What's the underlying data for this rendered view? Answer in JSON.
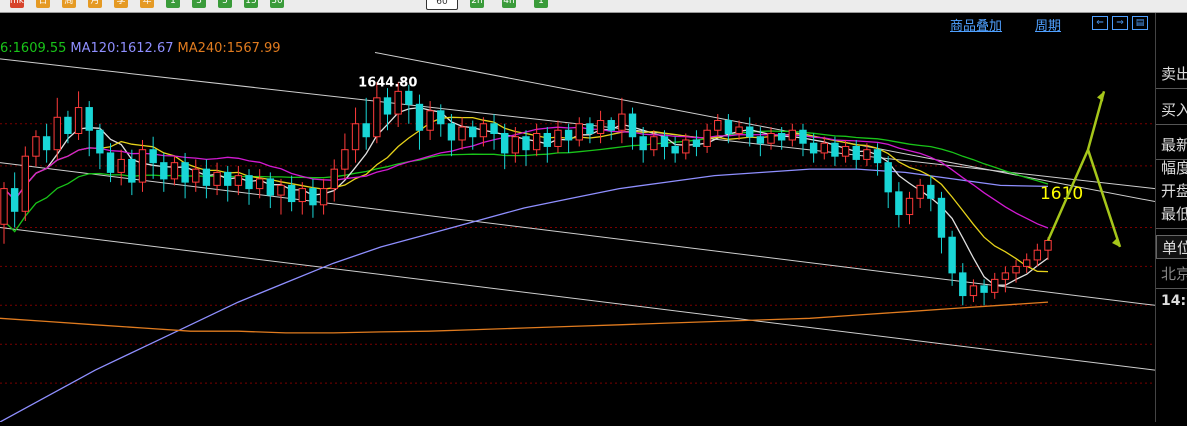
{
  "toolbar": {
    "buttons": [
      {
        "label": "mk",
        "color": "#d7432b"
      },
      {
        "label": "日",
        "color": "#e59a24"
      },
      {
        "label": "周",
        "color": "#e59a24"
      },
      {
        "label": "月",
        "color": "#e59a24"
      },
      {
        "label": "季",
        "color": "#e59a24"
      },
      {
        "label": "年",
        "color": "#e59a24"
      },
      {
        "label": "1",
        "color": "#3a9b3a"
      },
      {
        "label": "3",
        "color": "#3a9b3a"
      },
      {
        "label": "5",
        "color": "#3a9b3a"
      },
      {
        "label": "15",
        "color": "#3a9b3a"
      },
      {
        "label": "30",
        "color": "#3a9b3a"
      },
      {
        "label": "60",
        "color": "#ffffff",
        "selected": true
      },
      {
        "label": "2h",
        "color": "#3a9b3a"
      },
      {
        "label": "4h",
        "color": "#3a9b3a"
      },
      {
        "label": "1",
        "color": "#3a9b3a"
      }
    ]
  },
  "header_links": {
    "overlay": "商品叠加",
    "period": "周期"
  },
  "ma_legend": [
    {
      "text": "6:1609.55",
      "color": "#19c419"
    },
    {
      "text": "MA120:1612.67",
      "color": "#8f8fff"
    },
    {
      "text": "MA240:1567.99",
      "color": "#e07b1f"
    }
  ],
  "right_panel": {
    "items": [
      "卖出",
      "买入",
      "最新",
      "幅度",
      "开盘",
      "最低",
      "单位",
      "北京",
      "14:"
    ]
  },
  "chart_data": {
    "type": "candlestick",
    "ylim": [
      1540,
      1660
    ],
    "annotations": [
      {
        "text": "1644.80",
        "x_index": 37,
        "y": 1644.8,
        "color": "#ffffff"
      },
      {
        "text": "1610",
        "x_index": 101,
        "y": 1610,
        "color": "#ffff00"
      }
    ],
    "price_levels": [
      1632,
      1619,
      1600,
      1588,
      1576,
      1564,
      1552
    ],
    "candles": [
      [
        1601,
        1612,
        1595,
        1614
      ],
      [
        1612,
        1605,
        1600,
        1617
      ],
      [
        1605,
        1622,
        1602,
        1625
      ],
      [
        1622,
        1628,
        1619,
        1630
      ],
      [
        1628,
        1624,
        1620,
        1632
      ],
      [
        1624,
        1634,
        1621,
        1640
      ],
      [
        1634,
        1629,
        1626,
        1636
      ],
      [
        1629,
        1637,
        1627,
        1642
      ],
      [
        1637,
        1630,
        1622,
        1639
      ],
      [
        1630,
        1623,
        1618,
        1632
      ],
      [
        1623,
        1617,
        1614,
        1626
      ],
      [
        1617,
        1621,
        1613,
        1624
      ],
      [
        1621,
        1614,
        1610,
        1624
      ],
      [
        1614,
        1624,
        1611,
        1627
      ],
      [
        1624,
        1620,
        1615,
        1628
      ],
      [
        1620,
        1615,
        1611,
        1623
      ],
      [
        1615,
        1620,
        1613,
        1622
      ],
      [
        1620,
        1614,
        1609,
        1623
      ],
      [
        1614,
        1618,
        1611,
        1621
      ],
      [
        1618,
        1613,
        1609,
        1621
      ],
      [
        1613,
        1617,
        1610,
        1620
      ],
      [
        1617,
        1613,
        1608,
        1619
      ],
      [
        1613,
        1616,
        1610,
        1619
      ],
      [
        1616,
        1612,
        1607,
        1618
      ],
      [
        1612,
        1615,
        1609,
        1618
      ],
      [
        1615,
        1610,
        1606,
        1617
      ],
      [
        1610,
        1613,
        1604,
        1615
      ],
      [
        1613,
        1608,
        1605,
        1616
      ],
      [
        1608,
        1612,
        1604,
        1614
      ],
      [
        1612,
        1607,
        1603,
        1615
      ],
      [
        1607,
        1612,
        1604,
        1615
      ],
      [
        1612,
        1618,
        1608,
        1621
      ],
      [
        1618,
        1624,
        1615,
        1629
      ],
      [
        1624,
        1632,
        1620,
        1637
      ],
      [
        1632,
        1628,
        1624,
        1640
      ],
      [
        1628,
        1640,
        1626,
        1644.8
      ],
      [
        1640,
        1635,
        1630,
        1643
      ],
      [
        1635,
        1642,
        1631,
        1644.8
      ],
      [
        1642,
        1638,
        1632,
        1644
      ],
      [
        1638,
        1630,
        1624,
        1641
      ],
      [
        1630,
        1636,
        1627,
        1639
      ],
      [
        1636,
        1632,
        1628,
        1638
      ],
      [
        1632,
        1627,
        1622,
        1635
      ],
      [
        1627,
        1631,
        1624,
        1634
      ],
      [
        1631,
        1628,
        1624,
        1633
      ],
      [
        1628,
        1632,
        1625,
        1634
      ],
      [
        1632,
        1629,
        1624,
        1635
      ],
      [
        1629,
        1623,
        1618,
        1632
      ],
      [
        1623,
        1628,
        1620,
        1631
      ],
      [
        1628,
        1624,
        1619,
        1630
      ],
      [
        1624,
        1629,
        1622,
        1632
      ],
      [
        1629,
        1625,
        1620,
        1631
      ],
      [
        1625,
        1630,
        1623,
        1633
      ],
      [
        1630,
        1627,
        1623,
        1632
      ],
      [
        1627,
        1632,
        1625,
        1634
      ],
      [
        1632,
        1629,
        1626,
        1634
      ],
      [
        1629,
        1633,
        1626,
        1636
      ],
      [
        1633,
        1630,
        1627,
        1634
      ],
      [
        1630,
        1635,
        1626,
        1640
      ],
      [
        1635,
        1628,
        1624,
        1637
      ],
      [
        1628,
        1624,
        1620,
        1631
      ],
      [
        1624,
        1628,
        1622,
        1630
      ],
      [
        1628,
        1625,
        1621,
        1630
      ],
      [
        1625,
        1623,
        1620,
        1628
      ],
      [
        1623,
        1627,
        1621,
        1629
      ],
      [
        1627,
        1625,
        1622,
        1630
      ],
      [
        1625,
        1630,
        1623,
        1632
      ],
      [
        1630,
        1633,
        1628,
        1635
      ],
      [
        1633,
        1629,
        1626,
        1635
      ],
      [
        1629,
        1631,
        1627,
        1633
      ],
      [
        1631,
        1628,
        1625,
        1634
      ],
      [
        1628,
        1626,
        1622,
        1631
      ],
      [
        1626,
        1629,
        1624,
        1631
      ],
      [
        1629,
        1627,
        1624,
        1631
      ],
      [
        1627,
        1630,
        1625,
        1632
      ],
      [
        1630,
        1626,
        1622,
        1632
      ],
      [
        1626,
        1623,
        1620,
        1629
      ],
      [
        1623,
        1626,
        1621,
        1628
      ],
      [
        1626,
        1622,
        1619,
        1628
      ],
      [
        1622,
        1625,
        1620,
        1627
      ],
      [
        1625,
        1621,
        1618,
        1627
      ],
      [
        1621,
        1624,
        1619,
        1626
      ],
      [
        1624,
        1620,
        1616,
        1626
      ],
      [
        1620,
        1611,
        1606,
        1622
      ],
      [
        1611,
        1604,
        1600,
        1614
      ],
      [
        1604,
        1609,
        1601,
        1611
      ],
      [
        1609,
        1613,
        1606,
        1615
      ],
      [
        1613,
        1609,
        1605,
        1616
      ],
      [
        1609,
        1597,
        1592,
        1611
      ],
      [
        1597,
        1586,
        1582,
        1599
      ],
      [
        1586,
        1579,
        1576,
        1589
      ],
      [
        1579,
        1582,
        1577,
        1584
      ],
      [
        1582,
        1580,
        1576,
        1584
      ],
      [
        1580,
        1584,
        1578,
        1586
      ],
      [
        1584,
        1586,
        1580,
        1588
      ],
      [
        1586,
        1588,
        1583,
        1590
      ],
      [
        1588,
        1590,
        1586,
        1592
      ],
      [
        1590,
        1593,
        1588,
        1595
      ],
      [
        1593,
        1596,
        1590,
        1597
      ]
    ],
    "series": [
      {
        "name": "MA120",
        "color": "#8f8fff",
        "values": [
          1540,
          1548,
          1556,
          1563,
          1570,
          1577,
          1583,
          1589,
          1594,
          1598,
          1602,
          1606,
          1609,
          1612,
          1614,
          1616,
          1617,
          1618,
          1618,
          1617,
          1615,
          1613,
          1612.67
        ]
      },
      {
        "name": "MA240",
        "color": "#e07b1f",
        "values": [
          1572,
          1571,
          1570,
          1569,
          1568,
          1568,
          1567.5,
          1567.5,
          1567.8,
          1568,
          1568.5,
          1569,
          1569.5,
          1570,
          1570.5,
          1571,
          1571.5,
          1572,
          1573,
          1574,
          1575,
          1576,
          1577
        ]
      }
    ]
  }
}
